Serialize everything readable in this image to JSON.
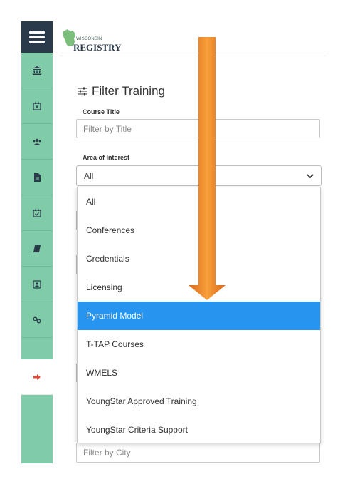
{
  "sidebar": {
    "menu_icon": "hamburger-menu-icon",
    "items": [
      {
        "icon": "institution-icon"
      },
      {
        "icon": "calendar-plus-icon"
      },
      {
        "icon": "users-icon"
      },
      {
        "icon": "document-icon"
      },
      {
        "icon": "calendar-check-icon"
      },
      {
        "icon": "book-icon"
      },
      {
        "icon": "contact-card-icon"
      },
      {
        "icon": "link-icon"
      },
      {
        "icon": "sign-out-icon",
        "active": true
      }
    ],
    "colors": {
      "bg": "#80cba8",
      "menu_bg": "#2b3a4a",
      "active_icon": "#e04a3a"
    }
  },
  "header": {
    "logo_small": "WISCONSIN",
    "logo_big": "REGISTRY"
  },
  "filter": {
    "title": "Filter Training",
    "course_title_label": "Course Title",
    "course_title_placeholder": "Filter by Title",
    "area_label": "Area of Interest",
    "area_selected": "All",
    "area_options": [
      "All",
      "Conferences",
      "Credentials",
      "Licensing",
      "Pyramid Model",
      "T-TAP Courses",
      "WMELS",
      "YoungStar Approved Training",
      "YoungStar Criteria Support"
    ],
    "highlighted_option": "Pyramid Model",
    "city_placeholder": "Filter by City",
    "highlight_color": "#2794f0"
  },
  "annotation": {
    "arrow_color": "#f08a24"
  }
}
